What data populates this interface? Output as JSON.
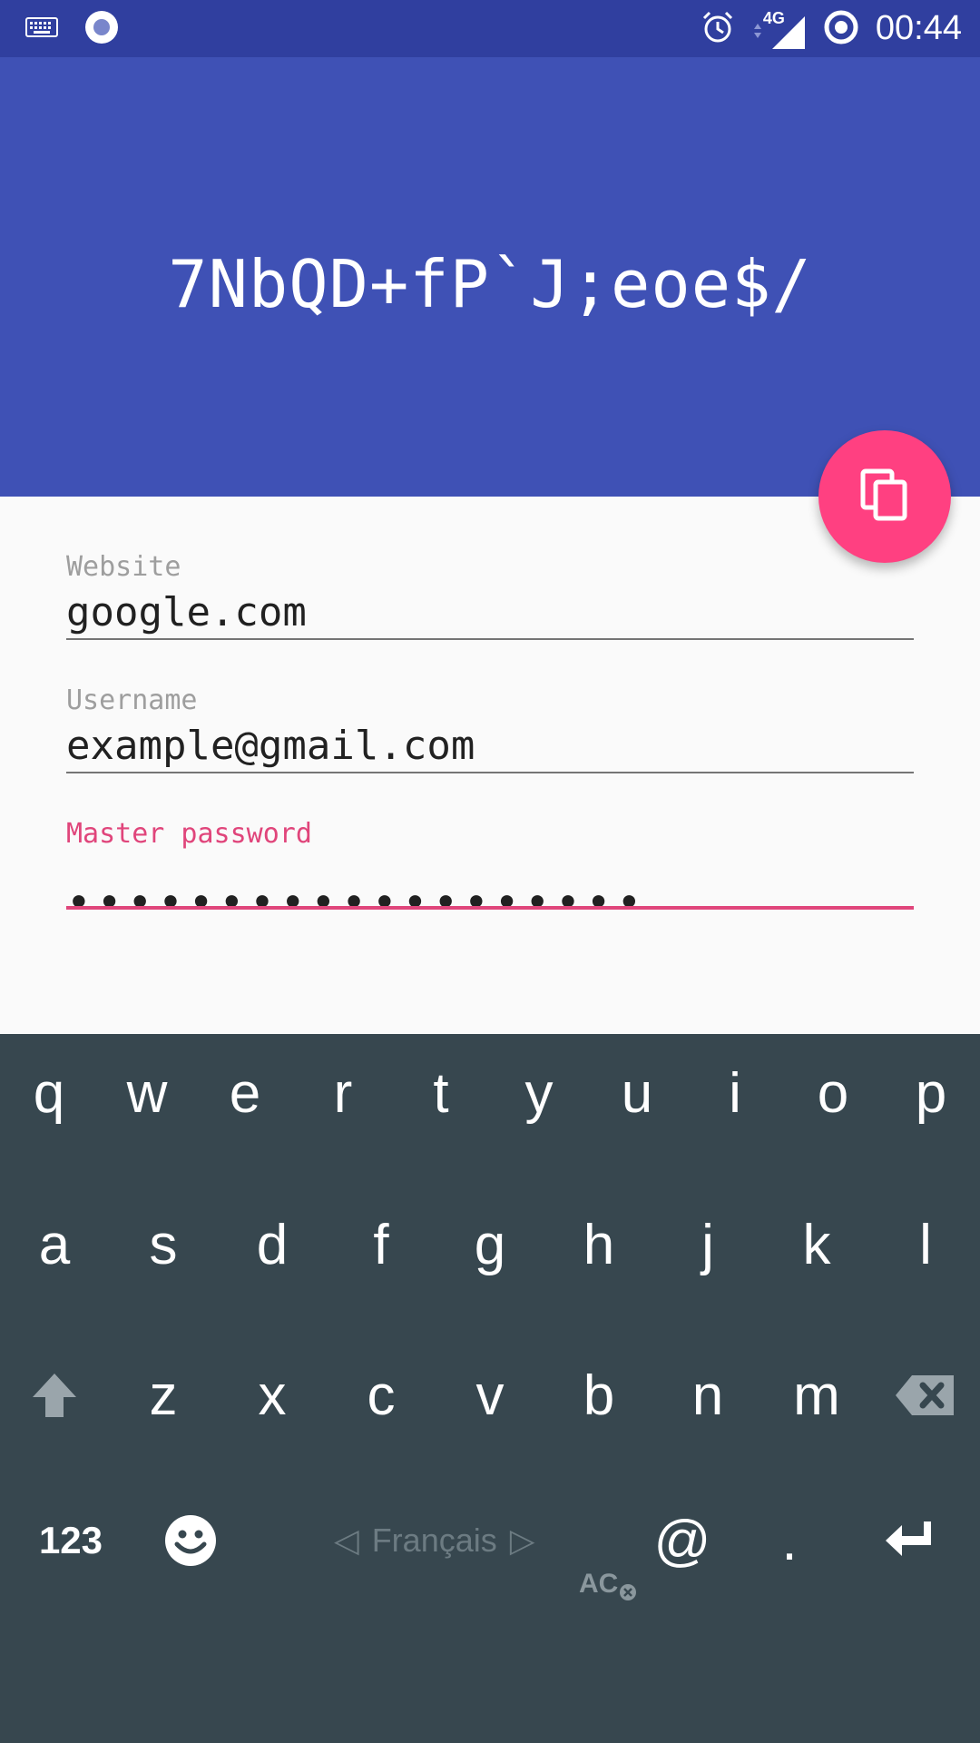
{
  "status_bar": {
    "time": "00:44",
    "network": "4G",
    "icons": [
      "keyboard-icon",
      "record-icon",
      "alarm-icon",
      "signal-icon",
      "sync-icon"
    ]
  },
  "header": {
    "generated_password": "7NbQD+fP`J;eoe$/"
  },
  "fab": {
    "icon": "copy-icon",
    "color": "#ff4081"
  },
  "form": {
    "website": {
      "label": "Website",
      "value": "google.com"
    },
    "username": {
      "label": "Username",
      "value": "example@gmail.com"
    },
    "master_password": {
      "label": "Master password",
      "masked_value": "•••••••••••••••••••"
    }
  },
  "keyboard": {
    "row1": [
      "q",
      "w",
      "e",
      "r",
      "t",
      "y",
      "u",
      "i",
      "o",
      "p"
    ],
    "row2": [
      "a",
      "s",
      "d",
      "f",
      "g",
      "h",
      "j",
      "k",
      "l"
    ],
    "row3": [
      "z",
      "x",
      "c",
      "v",
      "b",
      "n",
      "m"
    ],
    "numbers_label": "123",
    "language": "Français",
    "at_label": "@",
    "period_label": ".",
    "autocorrect_label": "AC"
  },
  "colors": {
    "primary_dark": "#303f9f",
    "primary": "#3f51b5",
    "accent": "#ff4081",
    "active_field": "#e0457b",
    "keyboard_bg": "#37474f"
  }
}
